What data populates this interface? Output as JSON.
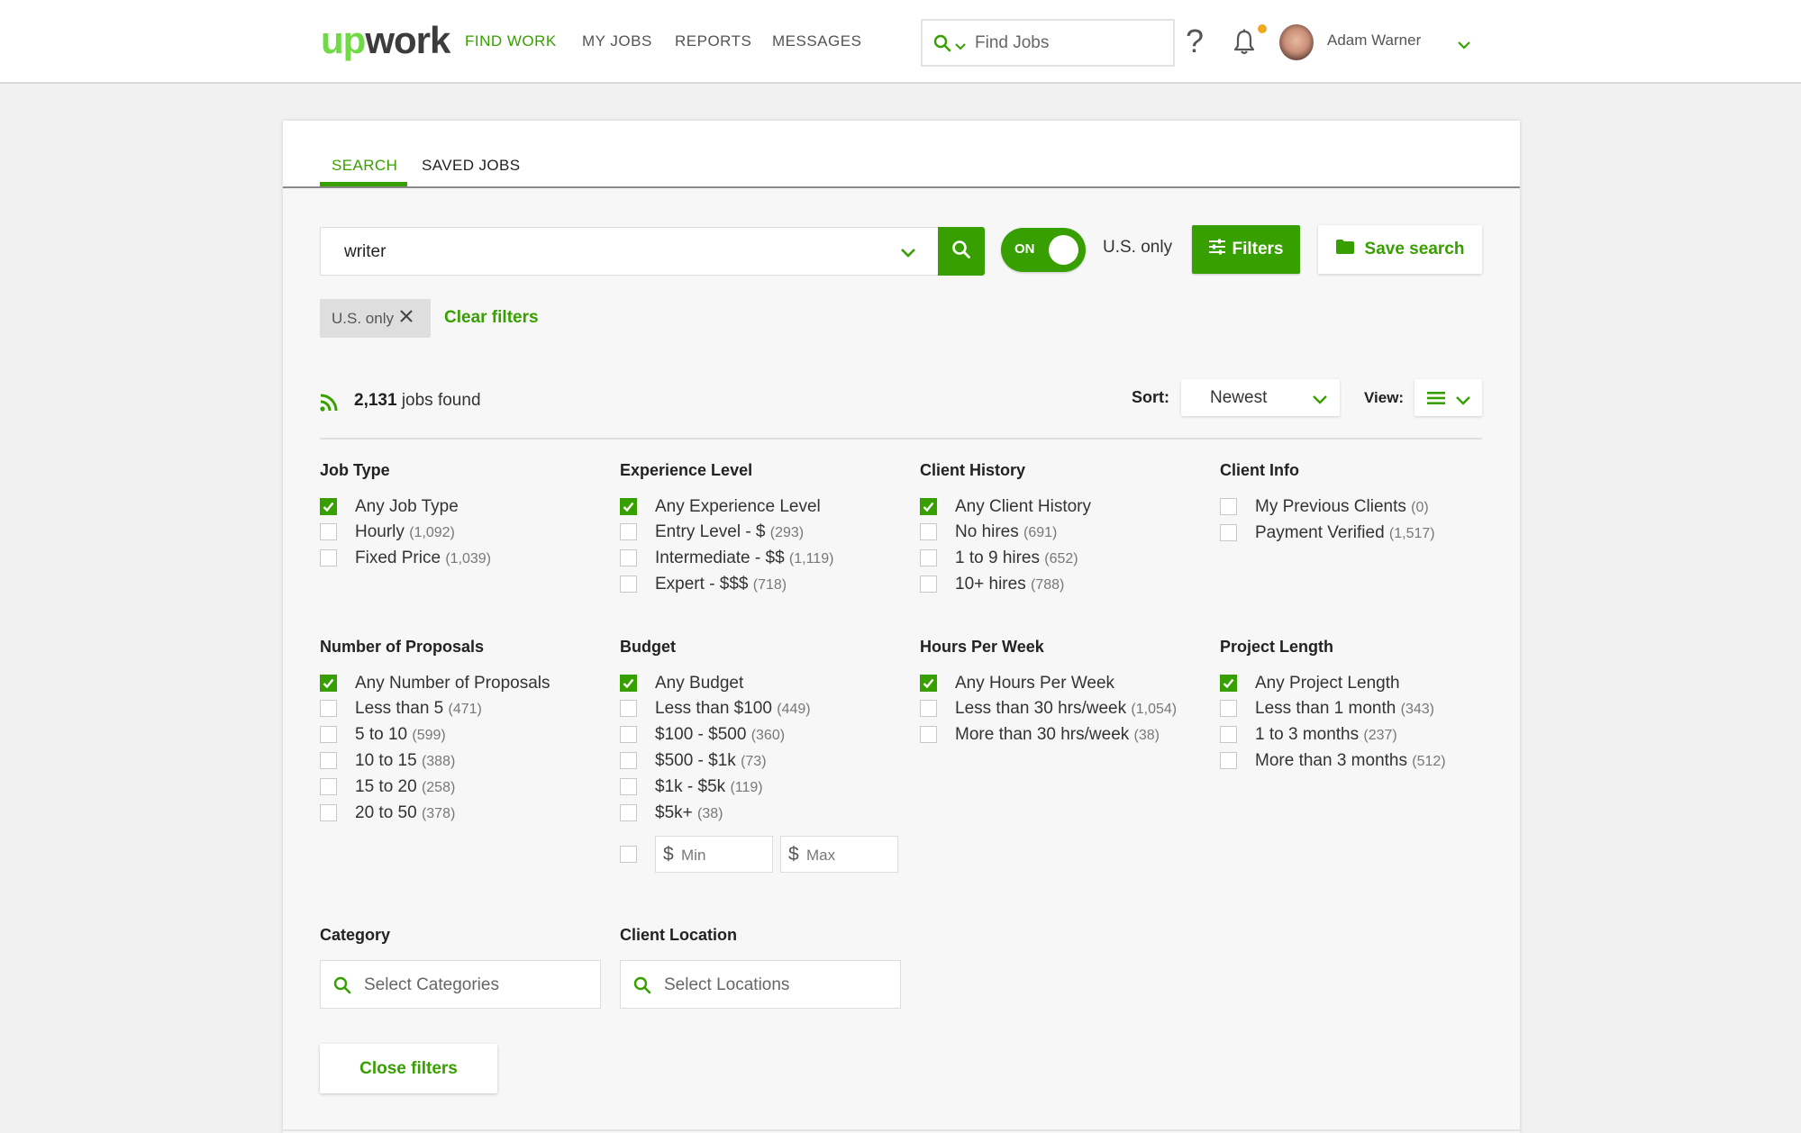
{
  "header": {
    "logo_up": "up",
    "logo_work": "work",
    "nav": [
      "FIND WORK",
      "MY JOBS",
      "REPORTS",
      "MESSAGES"
    ],
    "active_nav": "FIND WORK",
    "find_placeholder": "Find Jobs",
    "help_glyph": "?",
    "user_name": "Adam Warner",
    "icons": {
      "search": "search-icon",
      "help": "question-icon",
      "notifications": "bell-icon",
      "user_menu": "chevron-down-icon"
    }
  },
  "tabs": [
    "SEARCH",
    "SAVED JOBS"
  ],
  "active_tab": "SEARCH",
  "search": {
    "query": "writer",
    "toggle_label": "ON",
    "toggle_state": true,
    "toggle_caption": "U.S. only",
    "filters_label": "Filters",
    "save_label": "Save search"
  },
  "active_filters": {
    "chips": [
      "U.S. only"
    ],
    "clear_label": "Clear filters"
  },
  "results": {
    "count": "2,131",
    "suffix": " jobs found",
    "sort_label": "Sort:",
    "sort_value": "Newest",
    "view_label": "View:"
  },
  "filter_groups": [
    {
      "title": "Job Type",
      "options": [
        {
          "label": "Any Job Type",
          "count": "",
          "checked": true
        },
        {
          "label": "Hourly",
          "count": "(1,092)",
          "checked": false
        },
        {
          "label": "Fixed Price",
          "count": "(1,039)",
          "checked": false
        }
      ]
    },
    {
      "title": "Experience Level",
      "options": [
        {
          "label": "Any Experience Level",
          "count": "",
          "checked": true
        },
        {
          "label": "Entry Level - $",
          "count": "(293)",
          "checked": false
        },
        {
          "label": "Intermediate - $$",
          "count": "(1,119)",
          "checked": false
        },
        {
          "label": "Expert - $$$",
          "count": "(718)",
          "checked": false
        }
      ]
    },
    {
      "title": "Client History",
      "options": [
        {
          "label": "Any Client History",
          "count": "",
          "checked": true
        },
        {
          "label": "No hires",
          "count": "(691)",
          "checked": false
        },
        {
          "label": "1 to 9 hires",
          "count": "(652)",
          "checked": false
        },
        {
          "label": "10+ hires",
          "count": "(788)",
          "checked": false
        }
      ]
    },
    {
      "title": "Client Info",
      "options": [
        {
          "label": "My Previous Clients",
          "count": "(0)",
          "checked": false
        },
        {
          "label": "Payment Verified",
          "count": "(1,517)",
          "checked": false
        }
      ]
    },
    {
      "title": "Number of Proposals",
      "options": [
        {
          "label": "Any Number of Proposals",
          "count": "",
          "checked": true
        },
        {
          "label": "Less than 5",
          "count": "(471)",
          "checked": false
        },
        {
          "label": "5 to 10",
          "count": "(599)",
          "checked": false
        },
        {
          "label": "10 to 15",
          "count": "(388)",
          "checked": false
        },
        {
          "label": "15 to 20",
          "count": "(258)",
          "checked": false
        },
        {
          "label": "20 to 50",
          "count": "(378)",
          "checked": false
        }
      ]
    },
    {
      "title": "Budget",
      "options": [
        {
          "label": "Any Budget",
          "count": "",
          "checked": true
        },
        {
          "label": "Less than $100",
          "count": "(449)",
          "checked": false
        },
        {
          "label": "$100 - $500",
          "count": "(360)",
          "checked": false
        },
        {
          "label": "$500 - $1k",
          "count": "(73)",
          "checked": false
        },
        {
          "label": "$1k - $5k",
          "count": "(119)",
          "checked": false
        },
        {
          "label": "$5k+",
          "count": "(38)",
          "checked": false
        }
      ]
    },
    {
      "title": "Hours Per Week",
      "options": [
        {
          "label": "Any Hours Per Week",
          "count": "",
          "checked": true
        },
        {
          "label": "Less than 30 hrs/week",
          "count": "(1,054)",
          "checked": false
        },
        {
          "label": "More than 30 hrs/week",
          "count": "(38)",
          "checked": false
        }
      ]
    },
    {
      "title": "Project Length",
      "options": [
        {
          "label": "Any Project Length",
          "count": "",
          "checked": true
        },
        {
          "label": "Less than 1 month",
          "count": "(343)",
          "checked": false
        },
        {
          "label": "1 to 3 months",
          "count": "(237)",
          "checked": false
        },
        {
          "label": "More than 3 months",
          "count": "(512)",
          "checked": false
        }
      ]
    }
  ],
  "budget_range": {
    "currency": "$",
    "min_placeholder": "Min",
    "max_placeholder": "Max",
    "checked": false
  },
  "category": {
    "title": "Category",
    "placeholder": "Select Categories"
  },
  "client_location": {
    "title": "Client Location",
    "placeholder": "Select Locations"
  },
  "close_filters_label": "Close filters",
  "colors": {
    "brand_green": "#37a000",
    "logo_green": "#6fda44",
    "notification_dot": "#f0a820"
  }
}
